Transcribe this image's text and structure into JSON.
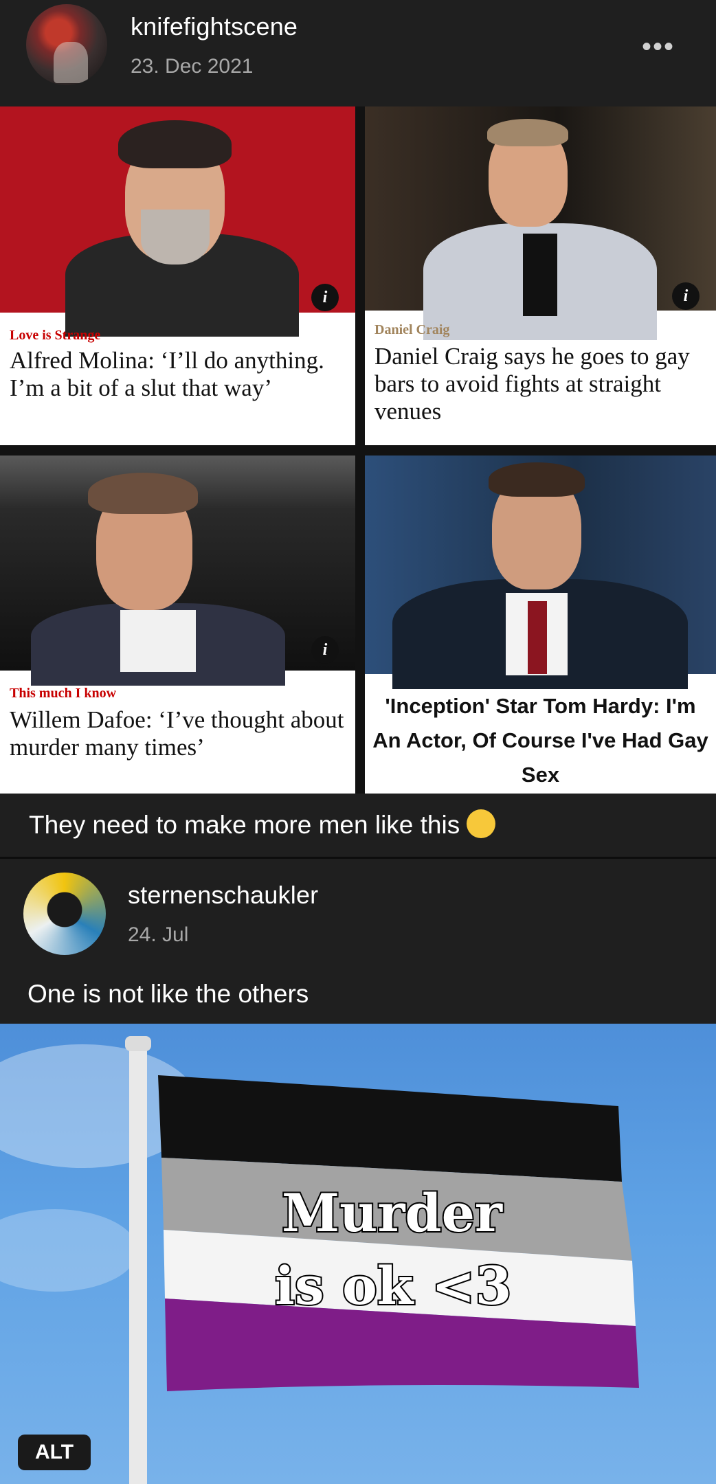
{
  "post": {
    "username": "knifefightscene",
    "date": "23. Dec 2021",
    "more_icon": "ellipsis-icon"
  },
  "articles": [
    {
      "kicker": "Love is Strange",
      "headline": "Alfred Molina: ‘I’ll do anything. I’m a bit of a slut that way’",
      "info": "i"
    },
    {
      "kicker": "Daniel Craig",
      "headline": "Daniel Craig says he goes to gay bars to avoid fights at straight venues",
      "info": "i"
    },
    {
      "kicker": "This much I know",
      "headline": "Willem Dafoe: ‘I’ve thought about murder many times’",
      "info": "i"
    },
    {
      "kicker": "",
      "headline": "'Inception' Star Tom Hardy: I'm An Actor, Of Course I've Had Gay Sex",
      "info": ""
    }
  ],
  "caption": {
    "text": "They need to make more men like this",
    "emoji": "pensive-face"
  },
  "reblog": {
    "username": "sternenschaukler",
    "date": "24. Jul",
    "text": "One is not like the others"
  },
  "meme": {
    "line1": "Murder",
    "line2": "is ok <3",
    "alt_label": "ALT",
    "colors": {
      "flag_black": "#111111",
      "flag_gray": "#a3a3a3",
      "flag_white": "#f4f4f4",
      "flag_purple": "#7f1d88",
      "sky": "#5ea1e4"
    }
  }
}
